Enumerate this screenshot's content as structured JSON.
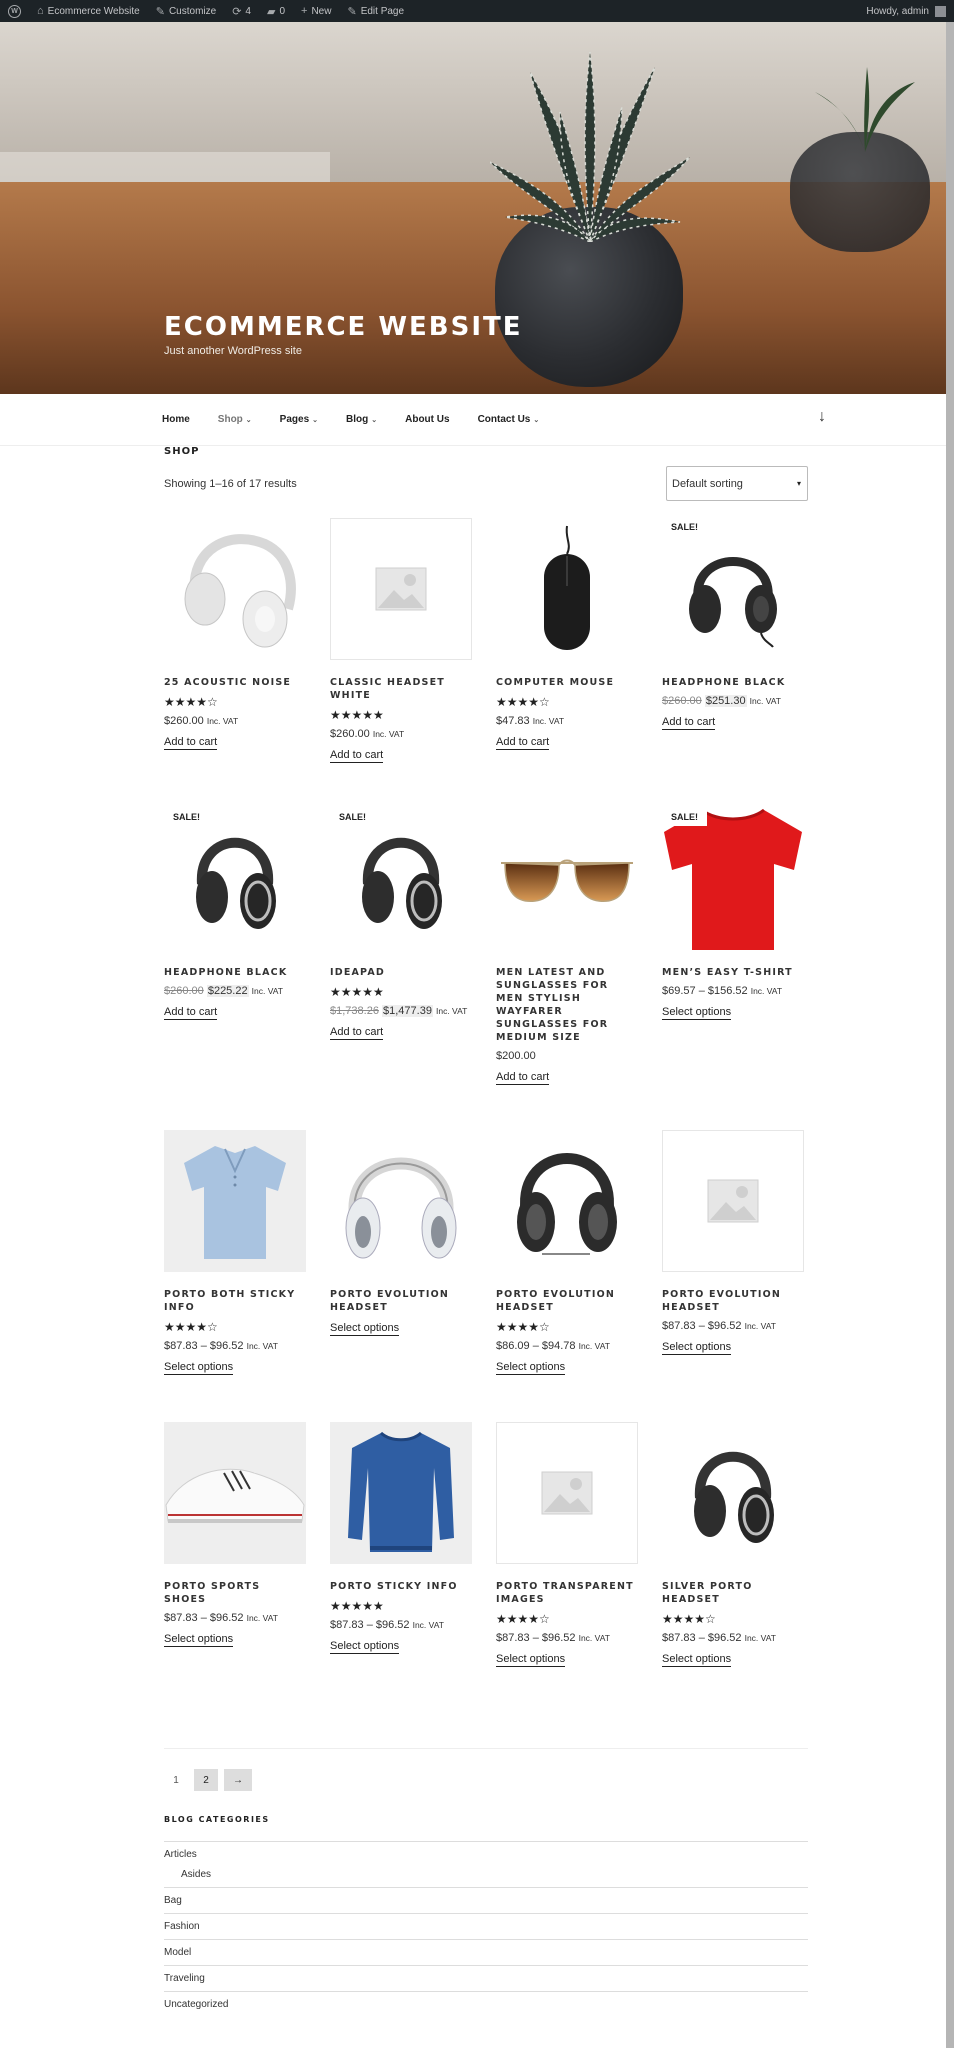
{
  "admin_bar": {
    "site_name": "Ecommerce Website",
    "customize": "Customize",
    "updates": "4",
    "comments": "0",
    "new": "New",
    "edit": "Edit Page",
    "greeting": "Howdy, admin"
  },
  "hero": {
    "title": "ECOMMERCE WEBSITE",
    "tagline": "Just another WordPress site"
  },
  "nav": {
    "items": [
      {
        "label": "Home"
      },
      {
        "label": "Shop"
      },
      {
        "label": "Pages"
      },
      {
        "label": "Blog"
      },
      {
        "label": "About Us"
      },
      {
        "label": "Contact Us"
      }
    ]
  },
  "shop": {
    "title": "SHOP",
    "result_count": "Showing 1–16 of 17 results",
    "sorting": "Default sorting"
  },
  "colors": {
    "admin_bar_bg": "#1d2327",
    "sale_badge_bg": "#ffffff",
    "link_text": "#222222"
  },
  "products": [
    {
      "name": "25 ACOUSTIC NOISE",
      "rating": 4,
      "stars": "★★★★☆",
      "price": "$260.00",
      "vat": "Inc. VAT",
      "button": "Add to cart",
      "image": "white-headphones"
    },
    {
      "name": "CLASSIC HEADSET WHITE",
      "rating": 5,
      "stars": "★★★★★",
      "price": "$260.00",
      "vat": "Inc. VAT",
      "button": "Add to cart",
      "image": "placeholder"
    },
    {
      "name": "COMPUTER MOUSE",
      "rating": 4,
      "stars": "★★★★☆",
      "price": "$47.83",
      "vat": "Inc. VAT",
      "button": "Add to cart",
      "image": "black-mouse"
    },
    {
      "name": "HEADPHONE BLACK",
      "sale": "SALE!",
      "old_price": "$260.00",
      "price": "$251.30",
      "vat": "Inc. VAT",
      "button": "Add to cart",
      "image": "black-headphones"
    },
    {
      "name": "HEADPHONE BLACK",
      "sale": "SALE!",
      "old_price": "$260.00",
      "price": "$225.22",
      "vat": "Inc. VAT",
      "button": "Add to cart",
      "image": "black-silver-headphones"
    },
    {
      "name": "IDEAPAD",
      "sale": "SALE!",
      "rating": 4.5,
      "stars": "★★★★★",
      "old_price": "$1,738.26",
      "price": "$1,477.39",
      "vat": "Inc. VAT",
      "button": "Add to cart",
      "image": "black-silver-headphones"
    },
    {
      "name": "MEN LATEST AND SUNGLASSES FOR MEN STYLISH WAYFARER SUNGLASSES FOR MEDIUM SIZE",
      "price": "$200.00",
      "button": "Add to cart",
      "image": "sunglasses"
    },
    {
      "name": "MEN’S EASY T-SHIRT",
      "sale": "SALE!",
      "price": "$69.57 – $156.52",
      "vat": "Inc. VAT",
      "button": "Select options",
      "image": "red-tshirt"
    },
    {
      "name": "PORTO BOTH STICKY INFO",
      "rating": 4,
      "stars": "★★★★☆",
      "price": "$87.83 – $96.52",
      "vat": "Inc. VAT",
      "button": "Select options",
      "image": "blue-polo"
    },
    {
      "name": "PORTO EVOLUTION HEADSET",
      "button": "Select options",
      "image": "white-headphones-front"
    },
    {
      "name": "PORTO EVOLUTION HEADSET",
      "rating": 4,
      "stars": "★★★★☆",
      "price": "$86.09 – $94.78",
      "vat": "Inc. VAT",
      "button": "Select options",
      "image": "black-headphones-front"
    },
    {
      "name": "PORTO EVOLUTION HEADSET",
      "price": "$87.83 – $96.52",
      "vat": "Inc. VAT",
      "button": "Select options",
      "image": "placeholder"
    },
    {
      "name": "PORTO SPORTS SHOES",
      "price": "$87.83 – $96.52",
      "vat": "Inc. VAT",
      "button": "Select options",
      "image": "white-sneakers"
    },
    {
      "name": "PORTO STICKY INFO",
      "rating": 5,
      "stars": "★★★★★",
      "price": "$87.83 – $96.52",
      "vat": "Inc. VAT",
      "button": "Select options",
      "image": "blue-sweater"
    },
    {
      "name": "PORTO TRANSPARENT IMAGES",
      "rating": 4,
      "stars": "★★★★☆",
      "price": "$87.83 – $96.52",
      "vat": "Inc. VAT",
      "button": "Select options",
      "image": "placeholder"
    },
    {
      "name": "SILVER PORTO HEADSET",
      "rating": 4,
      "stars": "★★★★☆",
      "price": "$87.83 – $96.52",
      "vat": "Inc. VAT",
      "button": "Select options",
      "image": "black-silver-headphones"
    }
  ],
  "pagination": {
    "pages": [
      "1",
      "2"
    ],
    "next": "→"
  },
  "blog_categories": {
    "title": "BLOG CATEGORIES",
    "items": [
      {
        "label": "Articles",
        "child": "Asides"
      },
      {
        "label": "Bag"
      },
      {
        "label": "Fashion"
      },
      {
        "label": "Model"
      },
      {
        "label": "Traveling"
      },
      {
        "label": "Uncategorized"
      }
    ]
  }
}
